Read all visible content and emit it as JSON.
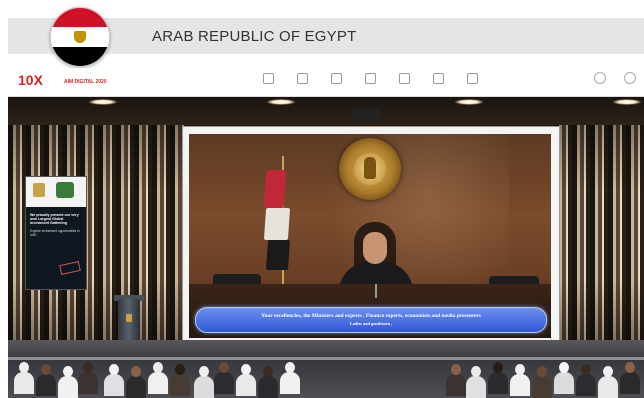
{
  "country_banner": {
    "name": "ARAB REPUBLIC OF EGYPT",
    "flag_icon": "egypt-flag-icon",
    "flag_colors": [
      "#ce1126",
      "#ffffff",
      "#000000"
    ]
  },
  "app_bar": {
    "logo": "10X",
    "event_title": "AIM DIGITAL 2020"
  },
  "info_panel": {
    "heading": "We proudly present our very own Largest Global Investment Gathering",
    "subheading": "Explore investment opportunities in UAE"
  },
  "video": {
    "subtitle_line1": "Your excellencies, the Ministers and experts , Finance experts, economists and media presenters",
    "subtitle_line2": "Ladies and gentlemen ,",
    "subtitle_color": "#2f57d6"
  },
  "colors": {
    "banner_bg": "#e5e5e7",
    "brand_red": "#dd2222"
  }
}
